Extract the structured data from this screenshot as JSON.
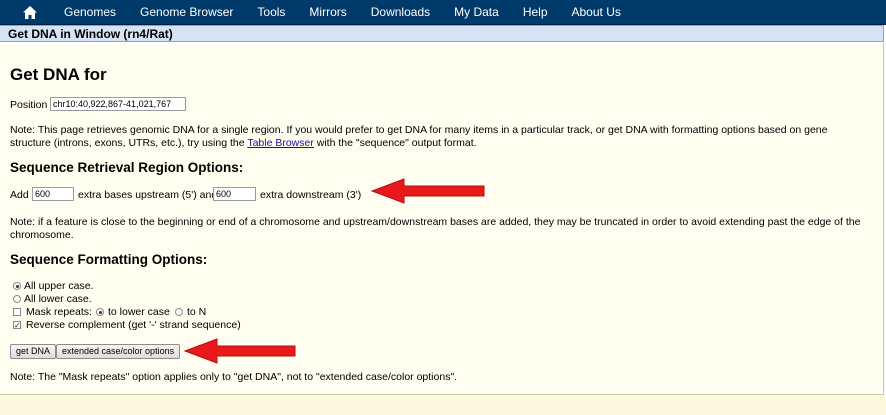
{
  "nav": {
    "items": [
      "Genomes",
      "Genome Browser",
      "Tools",
      "Mirrors",
      "Downloads",
      "My Data",
      "Help",
      "About Us"
    ]
  },
  "title_bar": "Get DNA in Window (rn4/Rat)",
  "page": {
    "heading": "Get DNA for",
    "position_label": "Position",
    "position_value": "chr10:40,922,867-41,021,767",
    "note1_a": "Note: This page retrieves genomic DNA for a single region. If you would prefer to get DNA for many items in a particular track, or get DNA with formatting options based on gene structure (introns, exons, UTRs, etc.), try using the ",
    "note1_link": "Table Browser",
    "note1_b": " with the \"sequence\" output format."
  },
  "region": {
    "heading": "Sequence Retrieval Region Options:",
    "add_label": "Add",
    "upstream_value": "600",
    "upstream_label": "extra bases upstream (5') and",
    "downstream_value": "600",
    "downstream_label": "extra downstream (3')",
    "note": "Note: if a feature is close to the beginning or end of a chromosome and upstream/downstream bases are added, they may be truncated in order to avoid extending past the edge of the chromosome."
  },
  "formatting": {
    "heading": "Sequence Formatting Options:",
    "all_upper": "All upper case.",
    "all_lower": "All lower case.",
    "mask_repeats": "Mask repeats:",
    "to_lower": "to lower case",
    "to_n": "to N",
    "reverse_complement": "Reverse complement (get '-' strand sequence)",
    "check_mark": "✓"
  },
  "buttons": {
    "get_dna": "get DNA",
    "extended": "extended case/color options"
  },
  "footer_note": "Note: The \"Mask repeats\" option applies only to \"get DNA\", not to \"extended case/color options\".",
  "colors": {
    "navbar": "#003a6a",
    "title_bar": "#d5e3f5",
    "content_bg": "#fffef0",
    "arrow": "#e8181b"
  }
}
